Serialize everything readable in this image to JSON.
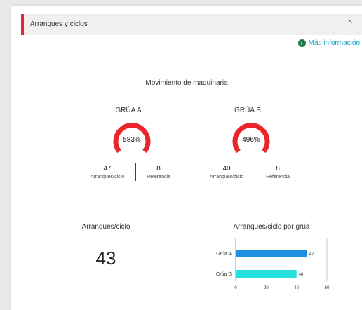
{
  "header": {
    "title": "Arranques y ciclos",
    "chevron": "^"
  },
  "more_info": {
    "icon": "info-icon",
    "label": "Más información"
  },
  "section_title": "Movimiento de maquinaria",
  "cranes": [
    {
      "name": "GRÚA A",
      "percent": "583%",
      "starts_per_cycle": "47",
      "starts_label": "Arranques/ciclo",
      "reference": "8",
      "reference_label": "Referencia"
    },
    {
      "name": "GRÚA B",
      "percent": "496%",
      "starts_per_cycle": "40",
      "starts_label": "Arranques/ciclo",
      "reference": "8",
      "reference_label": "Referencia"
    }
  ],
  "summary": {
    "label": "Arranques/ciclo",
    "value": "43"
  },
  "colors": {
    "accent": "#e8262b",
    "gauge": "#e8262b",
    "bar_a": "#1e90e0",
    "bar_b": "#27e0e0",
    "info": "#1e7a4b",
    "link": "#1aa0c4"
  },
  "chart_data": {
    "type": "bar",
    "orientation": "horizontal",
    "title": "Arranques/ciclo por grúa",
    "categories": [
      "Grúa A",
      "Grúa B"
    ],
    "values": [
      47,
      40
    ],
    "xlim": [
      0,
      60
    ],
    "xticks": [
      0,
      20,
      40,
      60
    ],
    "grid": false
  }
}
